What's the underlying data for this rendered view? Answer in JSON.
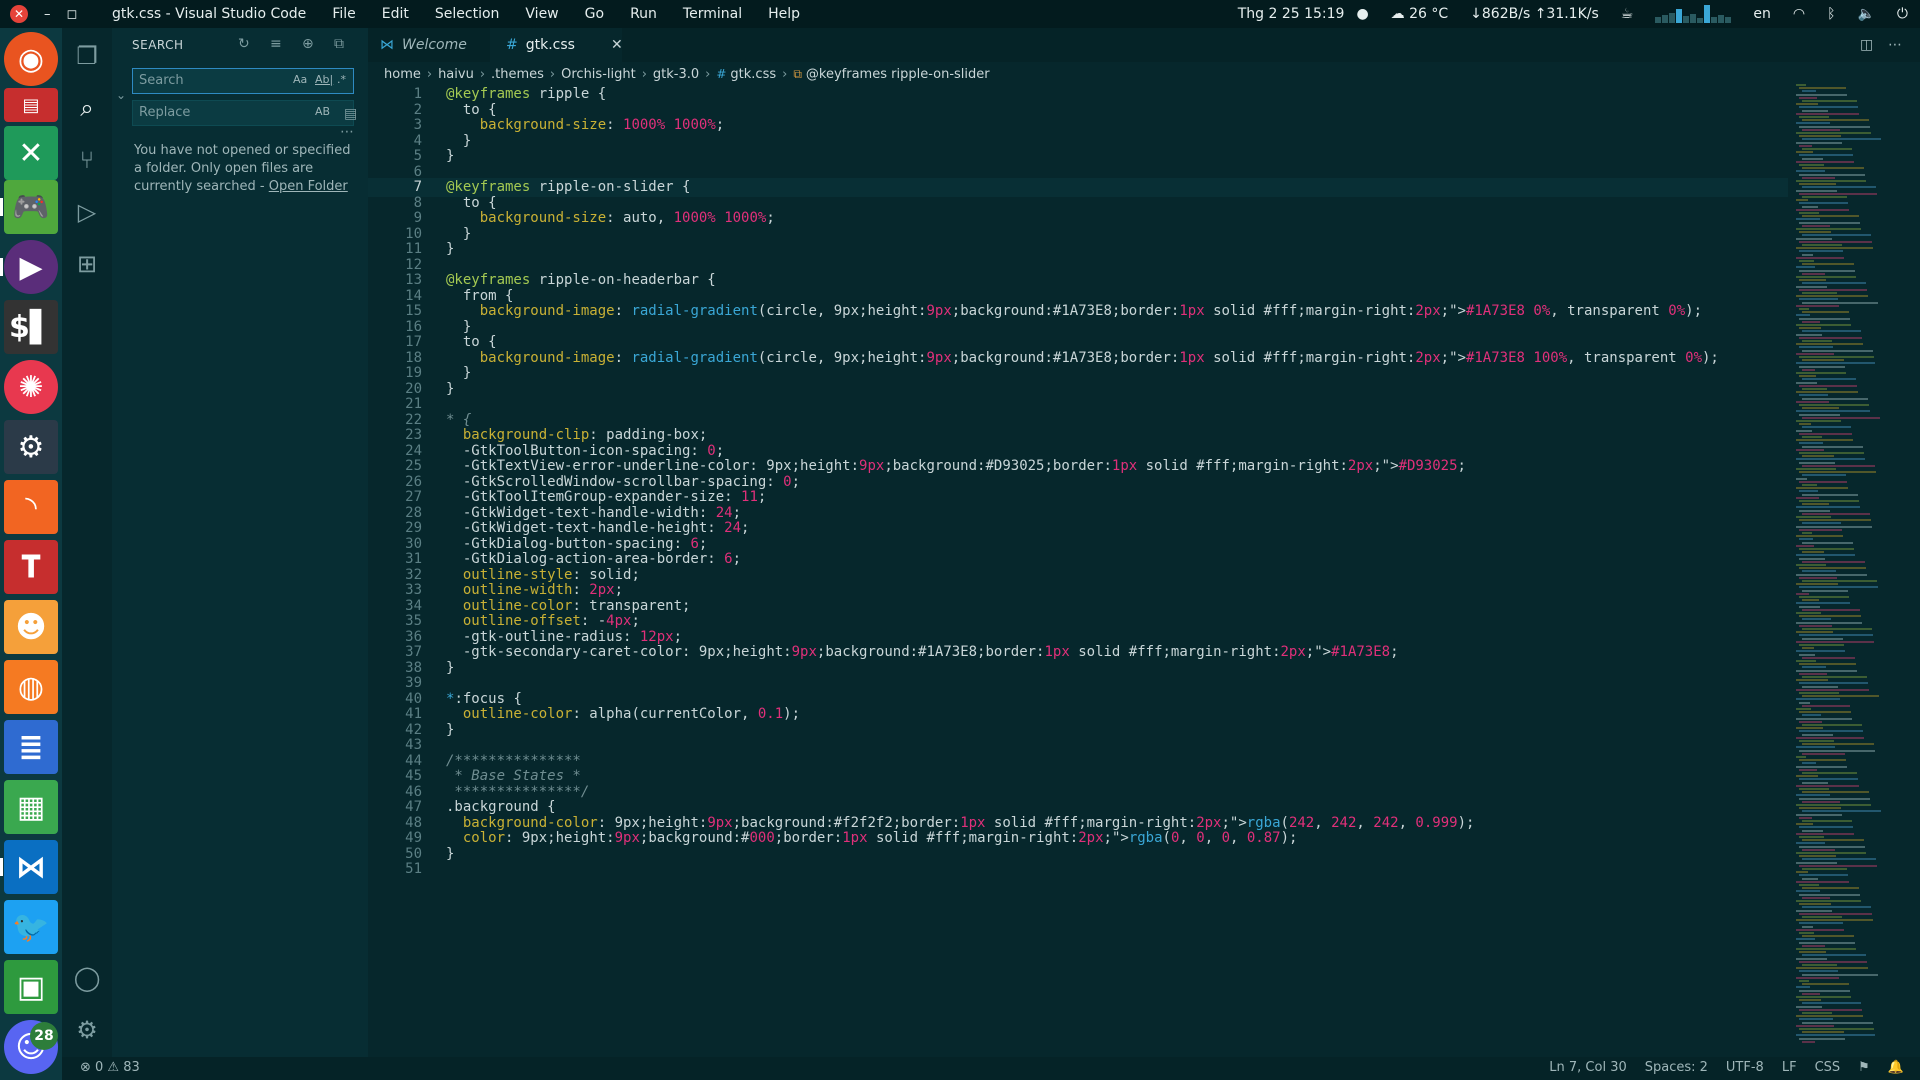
{
  "topbar": {
    "title": "gtk.css - Visual Studio Code",
    "menu": [
      "File",
      "Edit",
      "Selection",
      "View",
      "Go",
      "Run",
      "Terminal",
      "Help"
    ],
    "datetime": "Thg 2 25  15:19",
    "weather": "26 °C",
    "network": "↓862B/s ↑31.1K/s",
    "lang": "en"
  },
  "dock": {
    "items": [
      "ubuntu-icon",
      "files-icon",
      "crossover-icon",
      "gamepad-icon",
      "video-player-icon",
      "terminal-icon",
      "pinwheel-icon",
      "steam-icon",
      "rss-icon",
      "antenna-icon",
      "reddit-icon",
      "blender-icon",
      "writer-icon",
      "calc-icon",
      "vscode-icon",
      "twitter-icon",
      "media-icon",
      "discord-icon"
    ],
    "discord_badge": "28"
  },
  "sidebar": {
    "header": "SEARCH",
    "search_placeholder": "Search",
    "replace_placeholder": "Replace",
    "match_case": "Aa",
    "whole_word": "Ab|",
    "regex": ".*",
    "preserve_case": "AB",
    "message": "You have not opened or specified a folder. Only open files are currently searched - ",
    "open_folder": "Open Folder"
  },
  "tabs": [
    {
      "label": "Welcome",
      "active": false
    },
    {
      "label": "gtk.css",
      "active": true
    }
  ],
  "breadcrumb": [
    "home",
    "haivu",
    ".themes",
    "Orchis-light",
    "gtk-3.0",
    "gtk.css",
    "@keyframes ripple-on-slider"
  ],
  "code_lines": [
    "@keyframes ripple {",
    "  to {",
    "    background-size: 1000% 1000%;",
    "  }",
    "}",
    "",
    "@keyframes ripple-on-slider {",
    "  to {",
    "    background-size: auto, 1000% 1000%;",
    "  }",
    "}",
    "",
    "@keyframes ripple-on-headerbar {",
    "  from {",
    "    background-image: radial-gradient(circle, ■#1A73E8 0%, transparent 0%);",
    "  }",
    "  to {",
    "    background-image: radial-gradient(circle, ■#1A73E8 100%, transparent 0%);",
    "  }",
    "}",
    "",
    "* {",
    "  background-clip: padding-box;",
    "  -GtkToolButton-icon-spacing: 0;",
    "  -GtkTextView-error-underline-color: ■#D93025;",
    "  -GtkScrolledWindow-scrollbar-spacing: 0;",
    "  -GtkToolItemGroup-expander-size: 11;",
    "  -GtkWidget-text-handle-width: 24;",
    "  -GtkWidget-text-handle-height: 24;",
    "  -GtkDialog-button-spacing: 6;",
    "  -GtkDialog-action-area-border: 6;",
    "  outline-style: solid;",
    "  outline-width: 2px;",
    "  outline-color: transparent;",
    "  outline-offset: -4px;",
    "  -gtk-outline-radius: 12px;",
    "  -gtk-secondary-caret-color: ■#1A73E8;",
    "}",
    "",
    "*:focus {",
    "  outline-color: alpha(currentColor, 0.1);",
    "}",
    "",
    "/***************",
    " * Base States *",
    " ***************/",
    ".background {",
    "  background-color: ■rgba(242, 242, 242, 0.999);",
    "  color: □rgba(0, 0, 0, 0.87);",
    "}",
    ""
  ],
  "statusbar": {
    "problems": "⊗ 0  ⚠ 83",
    "position": "Ln 7, Col 30",
    "spaces": "Spaces: 2",
    "encoding": "UTF-8",
    "eol": "LF",
    "language": "CSS"
  },
  "colors": {
    "keyword": "#a4c952",
    "property": "#c9b135",
    "number": "#e0307a",
    "function": "#3aa7d6",
    "comment": "#6f8d91"
  }
}
